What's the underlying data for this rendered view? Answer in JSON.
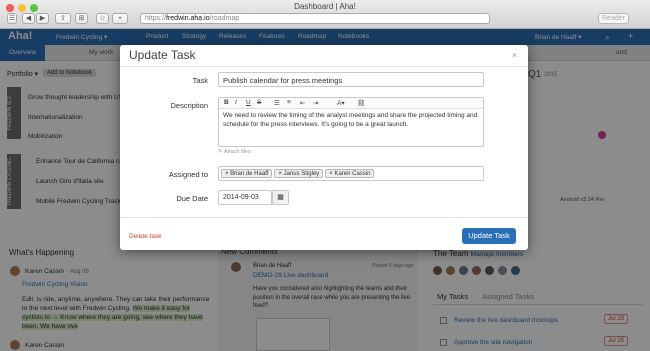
{
  "browser": {
    "window_title": "Dashboard | Aha!",
    "url_prefix": "https://",
    "url_host": "fredwin.aha.io",
    "url_path": "/roadmap",
    "reader": "Reader"
  },
  "app": {
    "logo": "Aha!",
    "workspace": "Fredwin Cycling",
    "nav": [
      "Product",
      "Strategy",
      "Releases",
      "Features",
      "Roadmap",
      "Notebooks"
    ],
    "user": "Brian de Haaff"
  },
  "subnav": {
    "overview": "Overview",
    "my_work": "My work",
    "right": "and"
  },
  "portfolio": {
    "label": "Portfolio",
    "add_btn": "Add to Notebook",
    "quarter": "Q1",
    "year": "2015"
  },
  "lanes": [
    "FREDWIN SCF",
    "FREDWIN CYCLING"
  ],
  "features": [
    "Grow thought leadership with US",
    "Internationalization",
    "Mobilization",
    "Enhance Tour de California cov",
    "Launch Giro d'Italia site",
    "Mobile Fredwin Cycling Tracker"
  ],
  "release_tag": "Android v3.24 Rel",
  "whats_happening": {
    "title": "What's Happening",
    "author": "Karen Cassin",
    "date": "Aug 06",
    "product": "Fredwin Cycling Vision",
    "text": "Edit: is ride, anytime, anywhere. They can take their performance to the next level with Fredwin Cycling.",
    "text_link": "We make it easy for cyclists to → Know where they are going, see where they have been. We have ove",
    "author2": "Karen Cassin"
  },
  "new_comments": {
    "title": "New Comments",
    "author": "Brian de Haaff",
    "time": "Posted 5 days ago",
    "link": "DEMO-29 Live dashboard",
    "body": "Have you considered also highlighting the teams and their position in the overall race while you are presenting the live feed?"
  },
  "team": {
    "title": "The Team",
    "manage": "Manage members",
    "tab_my": "My Tasks",
    "tab_assigned": "Assigned Tasks",
    "tasks": [
      {
        "name": "Review the live dashboard mockups",
        "date": "Jul 23"
      },
      {
        "name": "Approve the site navigation",
        "date": "Jul 25"
      }
    ]
  },
  "modal": {
    "title": "Update Task",
    "close": "×",
    "task_label": "Task",
    "task_value": "Publish calendar for press meetings",
    "desc_label": "Description",
    "desc_text": "We need to review the timing of the analyst meetings and share the projected timing and schedule for the press interviews. It's going to be a great launch.",
    "attach": "Attach files",
    "assigned_label": "Assigned to",
    "assignees": [
      "Brian de Haaff",
      "Janus Stigley",
      "Karen Cassin"
    ],
    "due_label": "Due Date",
    "due_value": "2014-09-03",
    "delete": "Delete task",
    "submit": "Update Task"
  }
}
